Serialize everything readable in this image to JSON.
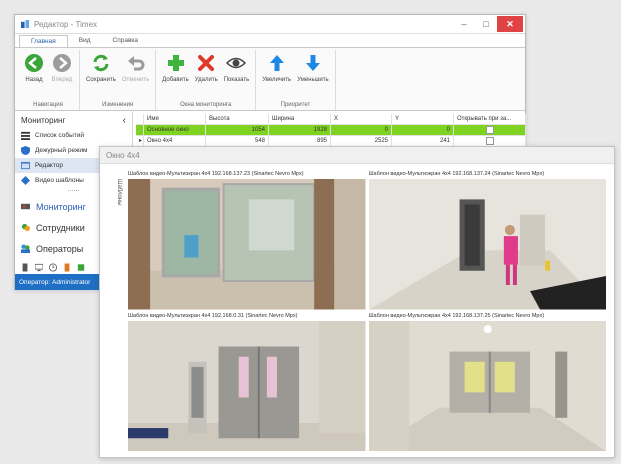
{
  "window": {
    "title": "Редактор - Timex",
    "controls": {
      "minimize": "–",
      "maximize": "□",
      "close": "✕"
    }
  },
  "tabs": [
    "Главная",
    "Вид",
    "Справка"
  ],
  "ribbon": {
    "groups": [
      {
        "label": "Навигация",
        "buttons": [
          {
            "label": "Назад",
            "icon": "back-arrow-icon"
          },
          {
            "label": "Вперед",
            "icon": "forward-arrow-icon"
          }
        ]
      },
      {
        "label": "Изменения",
        "buttons": [
          {
            "label": "Сохранить",
            "icon": "refresh-save-icon"
          },
          {
            "label": "Отменить",
            "icon": "undo-icon"
          }
        ]
      },
      {
        "label": "Окна мониторинга",
        "buttons": [
          {
            "label": "Добавить",
            "icon": "plus-icon"
          },
          {
            "label": "Удалить",
            "icon": "delete-x-icon"
          },
          {
            "label": "Показать",
            "icon": "eye-icon"
          }
        ]
      },
      {
        "label": "Приоритет",
        "buttons": [
          {
            "label": "Увеличить",
            "icon": "arrow-up-icon"
          },
          {
            "label": "Уменьшить",
            "icon": "arrow-down-icon"
          }
        ]
      }
    ]
  },
  "sidebar": {
    "header": "Мониторинг",
    "collapse_glyph": "‹",
    "items": [
      {
        "label": "Список событий",
        "icon": "list-icon"
      },
      {
        "label": "Дежурный режим",
        "icon": "shield-icon"
      },
      {
        "label": "Редактор",
        "icon": "editor-icon"
      },
      {
        "label": "Видео шаблоны",
        "icon": "video-template-icon"
      }
    ],
    "separator": "......",
    "nav": [
      {
        "label": "Мониторинг",
        "icon": "monitoring-icon"
      },
      {
        "label": "Сотрудники",
        "icon": "employees-icon"
      },
      {
        "label": "Операторы",
        "icon": "operators-icon"
      }
    ],
    "status": "Оператор: Administrator"
  },
  "table": {
    "columns": [
      "Имя",
      "Высота",
      "Ширина",
      "X",
      "Y",
      "Открывать при за..."
    ],
    "rows": [
      {
        "marker": "",
        "name": "Основное окно",
        "height": "1054",
        "width": "1928",
        "x": "0",
        "y": "0",
        "selected": true
      },
      {
        "marker": "▸",
        "name": "Окно 4x4",
        "height": "548",
        "width": "895",
        "x": "2525",
        "y": "241",
        "selected": false
      }
    ]
  },
  "viewer": {
    "title": "Окно 4x4",
    "side_tab": "Шаблоны",
    "cameras": [
      {
        "label": "Шаблон видео-Мультиэкран 4x4 192.168.137.23 (Sinartec Nevro Mpx)"
      },
      {
        "label": "Шаблон видео-Мультиэкран 4x4 192.168.137.24 (Sinartec Nevro Mpx)"
      },
      {
        "label": "Шаблон видео-Мультиэкран 4x4 192.168.0.31 (Sinartec Nevro Mpx)"
      },
      {
        "label": "Шаблон видео-Мультиэкран 4x4 192.168.137.25 (Sinartec Nevro Mpx)"
      }
    ]
  },
  "colors": {
    "accent": "#2a5fb3",
    "selected_row": "#7ed321",
    "status_bar": "#1f6fc4",
    "close_button": "#e04343"
  }
}
